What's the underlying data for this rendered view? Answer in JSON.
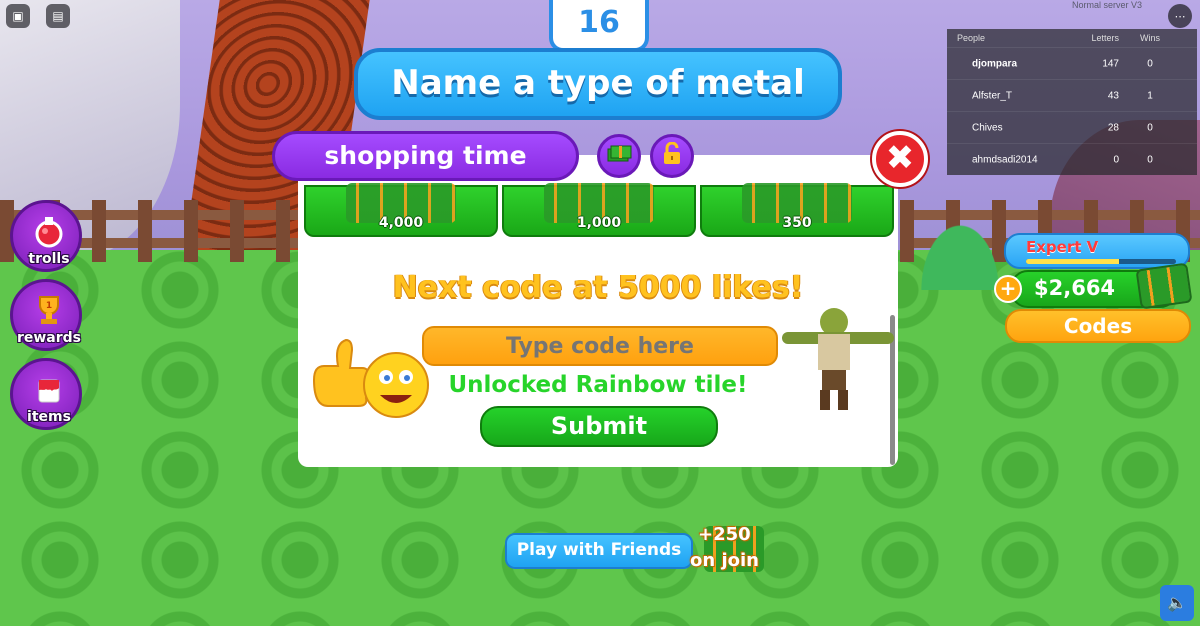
{
  "server": {
    "label": "Normal server V3"
  },
  "round": {
    "number": "16"
  },
  "prompt": {
    "text": "Name a type of metal"
  },
  "leaderboard": {
    "headers": {
      "people": "People",
      "letters": "Letters",
      "wins": "Wins"
    },
    "rows": [
      {
        "name": "djompara",
        "letters": "147",
        "wins": "0"
      },
      {
        "name": "Alfster_T",
        "letters": "43",
        "wins": "1"
      },
      {
        "name": "Chives",
        "letters": "28",
        "wins": "0"
      },
      {
        "name": "ahmdsadi2014",
        "letters": "0",
        "wins": "0"
      }
    ]
  },
  "side_menu": [
    {
      "label": "trolls",
      "icon": "potion-icon"
    },
    {
      "label": "rewards",
      "icon": "trophy-icon"
    },
    {
      "label": "items",
      "icon": "paint-bucket-icon"
    }
  ],
  "shop": {
    "title": "shopping time",
    "icons": [
      "cash-icon",
      "unlock-icon"
    ],
    "packs": [
      "4,000",
      "1,000",
      "350"
    ],
    "next_code": "Next code at 5000 likes!",
    "code_placeholder": "Type code here",
    "message": "Unlocked Rainbow tile!",
    "submit": "Submit"
  },
  "stats": {
    "rank": "Expert V",
    "rank_progress": 0.62,
    "plus": "+",
    "money": "$2,664",
    "codes": "Codes"
  },
  "bottom": {
    "play_friends": "Play with Friends",
    "bonus_amount": "+250",
    "bonus_label": "on join"
  },
  "colors": {
    "accent_purple": "#8a2be2",
    "accent_blue": "#1fa3f2",
    "accent_green": "#1aa817",
    "accent_orange": "#ffa40f",
    "close_red": "#e8262c"
  }
}
